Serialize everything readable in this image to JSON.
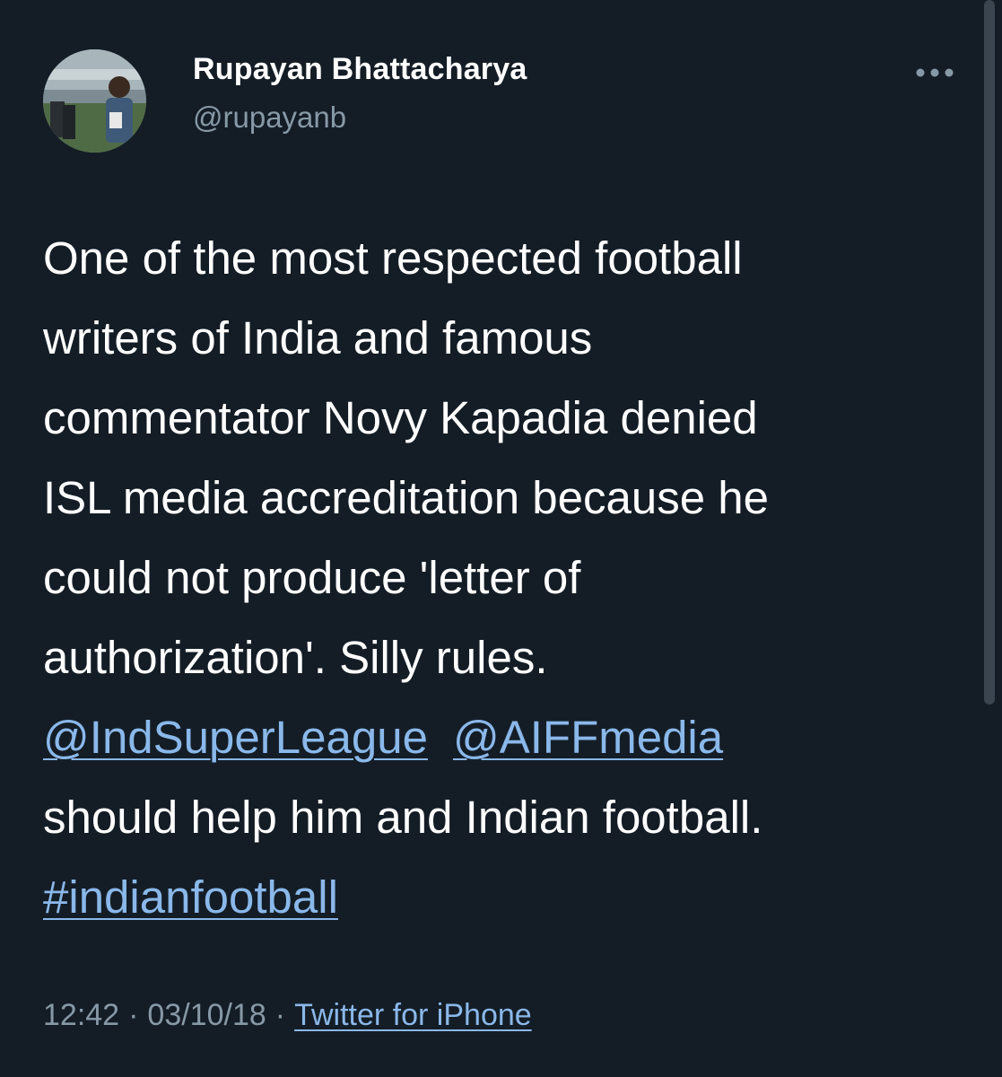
{
  "author": {
    "display_name": "Rupayan Bhattacharya",
    "handle": "@rupayanb"
  },
  "icons": {
    "avatar": "profile-photo",
    "more": "more-options-icon"
  },
  "tweet": {
    "lines": [
      "One of the most respected football",
      "writers of India and famous",
      "commentator Novy Kapadia denied",
      "ISL media accreditation because he",
      "could not produce 'letter of",
      "authorization'. Silly rules."
    ],
    "mentions": [
      "@IndSuperLeague",
      "@AIFFmedia"
    ],
    "after_mentions": "should help him and Indian football.",
    "hashtag": "#indianfootball"
  },
  "meta": {
    "time": "12:42",
    "separator": "·",
    "date": "03/10/18",
    "source": "Twitter for iPhone"
  },
  "colors": {
    "background": "#141d26",
    "text": "#ffffff",
    "secondary_text": "#8899a6",
    "link": "#8ab8ea"
  }
}
